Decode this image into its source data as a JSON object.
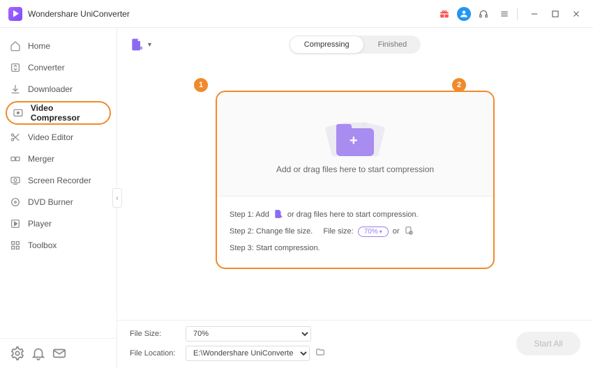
{
  "app": {
    "title": "Wondershare UniConverter"
  },
  "sidebar": {
    "items": [
      {
        "label": "Home"
      },
      {
        "label": "Converter"
      },
      {
        "label": "Downloader"
      },
      {
        "label": "Video Compressor"
      },
      {
        "label": "Video Editor"
      },
      {
        "label": "Merger"
      },
      {
        "label": "Screen Recorder"
      },
      {
        "label": "DVD Burner"
      },
      {
        "label": "Player"
      },
      {
        "label": "Toolbox"
      }
    ]
  },
  "tabs": {
    "compressing": "Compressing",
    "finished": "Finished"
  },
  "drop": {
    "text": "Add or drag files here to start compression"
  },
  "steps": {
    "s1a": "Step 1: Add",
    "s1b": "or drag files here to start compression.",
    "s2a": "Step 2: Change file size.",
    "s2b": "File size:",
    "s2_value": "70%",
    "s2_or": "or",
    "s3": "Step 3: Start compression."
  },
  "footer": {
    "file_size_label": "File Size:",
    "file_size_value": "70%",
    "file_location_label": "File Location:",
    "file_location_value": "E:\\Wondershare UniConverte",
    "start": "Start All"
  },
  "annotations": {
    "b1": "1",
    "b2": "2"
  }
}
